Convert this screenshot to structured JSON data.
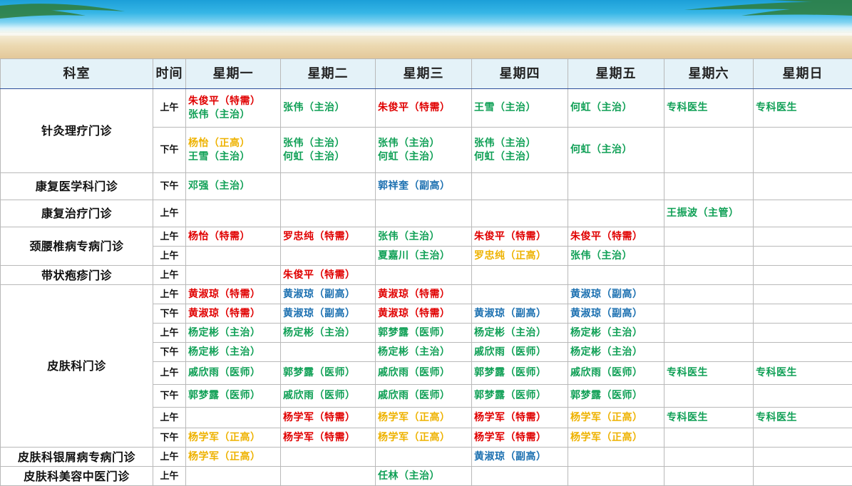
{
  "header": {
    "dept": "科室",
    "time": "时间",
    "days": [
      "星期一",
      "星期二",
      "星期三",
      "星期四",
      "星期五",
      "星期六",
      "星期日"
    ]
  },
  "colors": {
    "red": "#e00000",
    "green": "#10a056",
    "blue": "#1a6fb0",
    "yellow": "#eeb200",
    "header_bg": "#e4f2f8"
  },
  "schedule": [
    {
      "dept": "针灸理疗门诊",
      "rows": [
        {
          "time": "上午",
          "cells": [
            [
              {
                "t": "朱俊平（特需）",
                "c": "red"
              },
              {
                "t": "张伟（主治）",
                "c": "green"
              }
            ],
            [
              {
                "t": "张伟（主治）",
                "c": "green"
              }
            ],
            [
              {
                "t": "朱俊平（特需）",
                "c": "red"
              }
            ],
            [
              {
                "t": "王雪（主治）",
                "c": "green"
              }
            ],
            [
              {
                "t": "何虹（主治）",
                "c": "green"
              }
            ],
            [
              {
                "t": "专科医生",
                "c": "green"
              }
            ],
            [
              {
                "t": "专科医生",
                "c": "green"
              }
            ]
          ]
        },
        {
          "time": "下午",
          "cells": [
            [
              {
                "t": "杨怡（正高）",
                "c": "yellow"
              },
              {
                "t": "王雪（主治）",
                "c": "green"
              }
            ],
            [
              {
                "t": "张伟（主治）",
                "c": "green"
              },
              {
                "t": "何虹（主治）",
                "c": "green"
              }
            ],
            [
              {
                "t": "张伟（主治）",
                "c": "green"
              },
              {
                "t": "何虹（主治）",
                "c": "green"
              }
            ],
            [
              {
                "t": "张伟（主治）",
                "c": "green"
              },
              {
                "t": "何虹（主治）",
                "c": "green"
              }
            ],
            [
              {
                "t": "何虹（主治）",
                "c": "green"
              }
            ],
            [],
            []
          ]
        }
      ]
    },
    {
      "dept": "康复医学科门诊",
      "rows": [
        {
          "time": "下午",
          "cells": [
            [
              {
                "t": "邓强（主治）",
                "c": "green"
              }
            ],
            [],
            [
              {
                "t": "郭祥奎（副高）",
                "c": "blue"
              }
            ],
            [],
            [],
            [],
            []
          ]
        }
      ]
    },
    {
      "dept": "康复治疗门诊",
      "rows": [
        {
          "time": "上午",
          "cells": [
            [],
            [],
            [],
            [],
            [],
            [
              {
                "t": "王振波（主管）",
                "c": "green"
              }
            ],
            []
          ]
        }
      ]
    },
    {
      "dept": "颈腰椎病专病门诊",
      "rows": [
        {
          "time": "上午",
          "cells": [
            [
              {
                "t": "杨怡（特需）",
                "c": "red"
              }
            ],
            [
              {
                "t": "罗忠纯（特需）",
                "c": "red"
              }
            ],
            [
              {
                "t": "张伟（主治）",
                "c": "green"
              }
            ],
            [
              {
                "t": "朱俊平（特需）",
                "c": "red"
              }
            ],
            [
              {
                "t": "朱俊平（特需）",
                "c": "red"
              }
            ],
            [],
            []
          ]
        },
        {
          "time": "上午",
          "cells": [
            [],
            [],
            [
              {
                "t": "夏嘉川（主治）",
                "c": "green"
              }
            ],
            [
              {
                "t": "罗忠纯（正高）",
                "c": "yellow"
              }
            ],
            [
              {
                "t": "张伟（主治）",
                "c": "green"
              }
            ],
            [],
            []
          ]
        }
      ]
    },
    {
      "dept": "带状疱疹门诊",
      "rows": [
        {
          "time": "上午",
          "cells": [
            [],
            [
              {
                "t": "朱俊平（特需）",
                "c": "red"
              }
            ],
            [],
            [],
            [],
            [],
            []
          ]
        }
      ]
    },
    {
      "dept": "皮肤科门诊",
      "rows": [
        {
          "time": "上午",
          "cells": [
            [
              {
                "t": "黄淑琼（特需）",
                "c": "red"
              }
            ],
            [
              {
                "t": "黄淑琼（副高）",
                "c": "blue"
              }
            ],
            [
              {
                "t": "黄淑琼（特需）",
                "c": "red"
              }
            ],
            [],
            [
              {
                "t": "黄淑琼（副高）",
                "c": "blue"
              }
            ],
            [],
            []
          ]
        },
        {
          "time": "下午",
          "cells": [
            [
              {
                "t": "黄淑琼（特需）",
                "c": "red"
              }
            ],
            [
              {
                "t": "黄淑琼（副高）",
                "c": "blue"
              }
            ],
            [
              {
                "t": "黄淑琼（特需）",
                "c": "red"
              }
            ],
            [
              {
                "t": "黄淑琼（副高）",
                "c": "blue"
              }
            ],
            [
              {
                "t": "黄淑琼（副高）",
                "c": "blue"
              }
            ],
            [],
            []
          ]
        },
        {
          "time": "上午",
          "cells": [
            [
              {
                "t": "杨定彬（主治）",
                "c": "green"
              }
            ],
            [
              {
                "t": "杨定彬（主治）",
                "c": "green"
              }
            ],
            [
              {
                "t": "郭梦露（医师）",
                "c": "green"
              }
            ],
            [
              {
                "t": "杨定彬（主治）",
                "c": "green"
              }
            ],
            [
              {
                "t": "杨定彬（主治）",
                "c": "green"
              }
            ],
            [],
            []
          ]
        },
        {
          "time": "下午",
          "cells": [
            [
              {
                "t": "杨定彬（主治）",
                "c": "green"
              }
            ],
            [],
            [
              {
                "t": "杨定彬（主治）",
                "c": "green"
              }
            ],
            [
              {
                "t": "戚欣雨（医师）",
                "c": "green"
              }
            ],
            [
              {
                "t": "杨定彬（主治）",
                "c": "green"
              }
            ],
            [],
            []
          ]
        },
        {
          "time": "上午",
          "cells": [
            [
              {
                "t": "戚欣雨（医师）",
                "c": "green"
              }
            ],
            [
              {
                "t": "郭梦露（医师）",
                "c": "green"
              }
            ],
            [
              {
                "t": "戚欣雨（医师）",
                "c": "green"
              }
            ],
            [
              {
                "t": "郭梦露（医师）",
                "c": "green"
              }
            ],
            [
              {
                "t": "戚欣雨（医师）",
                "c": "green"
              }
            ],
            [
              {
                "t": "专科医生",
                "c": "green"
              }
            ],
            [
              {
                "t": "专科医生",
                "c": "green"
              }
            ]
          ]
        },
        {
          "time": "下午",
          "cells": [
            [
              {
                "t": "郭梦露（医师）",
                "c": "green"
              }
            ],
            [
              {
                "t": "戚欣雨（医师）",
                "c": "green"
              }
            ],
            [
              {
                "t": "戚欣雨（医师）",
                "c": "green"
              }
            ],
            [
              {
                "t": "郭梦露（医师）",
                "c": "green"
              }
            ],
            [
              {
                "t": "郭梦露（医师）",
                "c": "green"
              }
            ],
            [],
            []
          ]
        },
        {
          "time": "上午",
          "cells": [
            [],
            [
              {
                "t": "杨学军（特需）",
                "c": "red"
              }
            ],
            [
              {
                "t": "杨学军（正高）",
                "c": "yellow"
              }
            ],
            [
              {
                "t": "杨学军（特需）",
                "c": "red"
              }
            ],
            [
              {
                "t": "杨学军（正高）",
                "c": "yellow"
              }
            ],
            [
              {
                "t": "专科医生",
                "c": "green"
              }
            ],
            [
              {
                "t": "专科医生",
                "c": "green"
              }
            ]
          ]
        },
        {
          "time": "下午",
          "cells": [
            [
              {
                "t": "杨学军（正高）",
                "c": "yellow"
              }
            ],
            [
              {
                "t": "杨学军（特需）",
                "c": "red"
              }
            ],
            [
              {
                "t": "杨学军（正高）",
                "c": "yellow"
              }
            ],
            [
              {
                "t": "杨学军（特需）",
                "c": "red"
              }
            ],
            [
              {
                "t": "杨学军（正高）",
                "c": "yellow"
              }
            ],
            [],
            []
          ]
        }
      ]
    },
    {
      "dept": "皮肤科银屑病专病门诊",
      "rows": [
        {
          "time": "上午",
          "cells": [
            [
              {
                "t": "杨学军（正高）",
                "c": "yellow"
              }
            ],
            [],
            [],
            [
              {
                "t": "黄淑琼（副高）",
                "c": "blue"
              }
            ],
            [],
            [],
            []
          ]
        }
      ]
    },
    {
      "dept": "皮肤科美容中医门诊",
      "rows": [
        {
          "time": "上午",
          "cells": [
            [],
            [],
            [
              {
                "t": "任林（主治）",
                "c": "green"
              }
            ],
            [],
            [],
            [],
            []
          ]
        }
      ]
    }
  ]
}
